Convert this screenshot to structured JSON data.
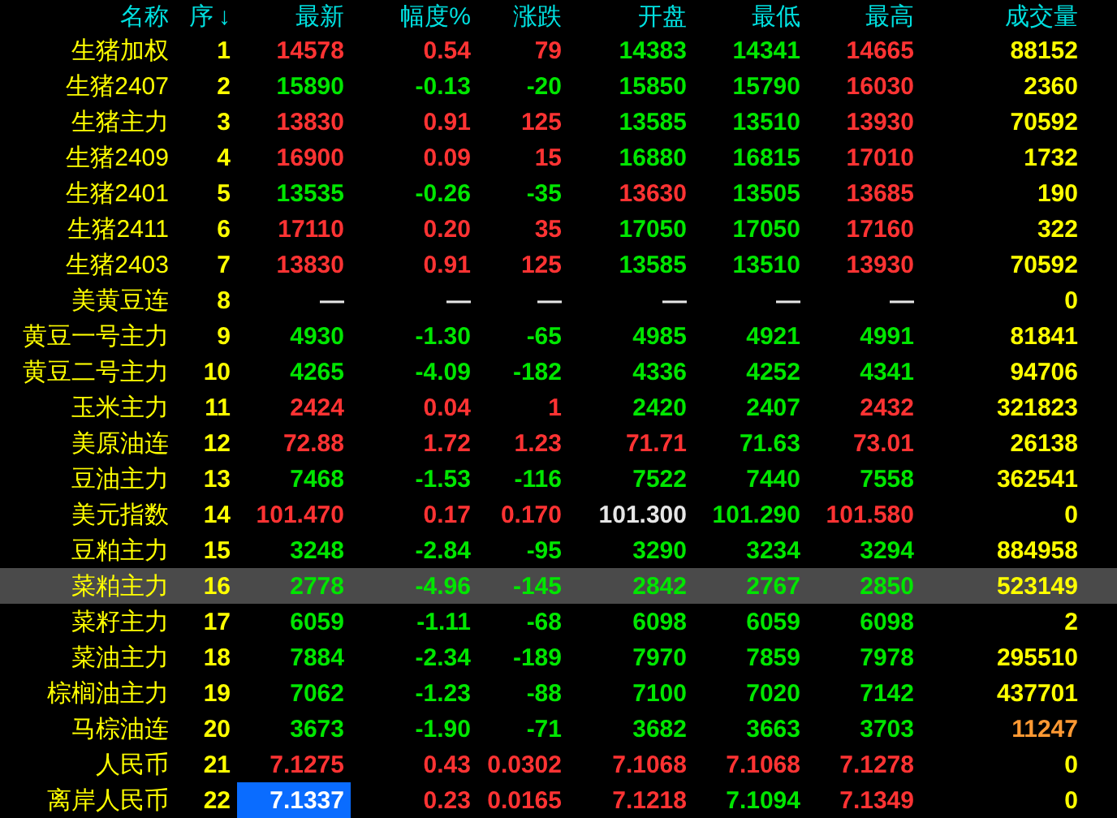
{
  "columns": [
    {
      "label": "名称"
    },
    {
      "label": "序",
      "sort_mark": "↓"
    },
    {
      "label": "最新"
    },
    {
      "label": "幅度%"
    },
    {
      "label": "涨跌"
    },
    {
      "label": "开盘"
    },
    {
      "label": "最低"
    },
    {
      "label": "最高"
    },
    {
      "label": "成交量"
    }
  ],
  "rows": [
    {
      "name": "生猪加权",
      "index": "1",
      "selected": false,
      "cells": [
        {
          "text": "14578",
          "color": "#ff3333"
        },
        {
          "text": "0.54",
          "color": "#ff3333"
        },
        {
          "text": "79",
          "color": "#ff3333"
        },
        {
          "text": "14383",
          "color": "#00e600"
        },
        {
          "text": "14341",
          "color": "#00e600"
        },
        {
          "text": "14665",
          "color": "#ff3333"
        },
        {
          "text": "88152",
          "color": "#ffff00"
        }
      ]
    },
    {
      "name": "生猪2407",
      "index": "2",
      "selected": false,
      "cells": [
        {
          "text": "15890",
          "color": "#00e600"
        },
        {
          "text": "-0.13",
          "color": "#00e600"
        },
        {
          "text": "-20",
          "color": "#00e600"
        },
        {
          "text": "15850",
          "color": "#00e600"
        },
        {
          "text": "15790",
          "color": "#00e600"
        },
        {
          "text": "16030",
          "color": "#ff3333"
        },
        {
          "text": "2360",
          "color": "#ffff00"
        }
      ]
    },
    {
      "name": "生猪主力",
      "index": "3",
      "selected": false,
      "cells": [
        {
          "text": "13830",
          "color": "#ff3333"
        },
        {
          "text": "0.91",
          "color": "#ff3333"
        },
        {
          "text": "125",
          "color": "#ff3333"
        },
        {
          "text": "13585",
          "color": "#00e600"
        },
        {
          "text": "13510",
          "color": "#00e600"
        },
        {
          "text": "13930",
          "color": "#ff3333"
        },
        {
          "text": "70592",
          "color": "#ffff00"
        }
      ]
    },
    {
      "name": "生猪2409",
      "index": "4",
      "selected": false,
      "cells": [
        {
          "text": "16900",
          "color": "#ff3333"
        },
        {
          "text": "0.09",
          "color": "#ff3333"
        },
        {
          "text": "15",
          "color": "#ff3333"
        },
        {
          "text": "16880",
          "color": "#00e600"
        },
        {
          "text": "16815",
          "color": "#00e600"
        },
        {
          "text": "17010",
          "color": "#ff3333"
        },
        {
          "text": "1732",
          "color": "#ffff00"
        }
      ]
    },
    {
      "name": "生猪2401",
      "index": "5",
      "selected": false,
      "cells": [
        {
          "text": "13535",
          "color": "#00e600"
        },
        {
          "text": "-0.26",
          "color": "#00e600"
        },
        {
          "text": "-35",
          "color": "#00e600"
        },
        {
          "text": "13630",
          "color": "#ff3333"
        },
        {
          "text": "13505",
          "color": "#00e600"
        },
        {
          "text": "13685",
          "color": "#ff3333"
        },
        {
          "text": "190",
          "color": "#ffff00"
        }
      ]
    },
    {
      "name": "生猪2411",
      "index": "6",
      "selected": false,
      "cells": [
        {
          "text": "17110",
          "color": "#ff3333"
        },
        {
          "text": "0.20",
          "color": "#ff3333"
        },
        {
          "text": "35",
          "color": "#ff3333"
        },
        {
          "text": "17050",
          "color": "#00e600"
        },
        {
          "text": "17050",
          "color": "#00e600"
        },
        {
          "text": "17160",
          "color": "#ff3333"
        },
        {
          "text": "322",
          "color": "#ffff00"
        }
      ]
    },
    {
      "name": "生猪2403",
      "index": "7",
      "selected": false,
      "cells": [
        {
          "text": "13830",
          "color": "#ff3333"
        },
        {
          "text": "0.91",
          "color": "#ff3333"
        },
        {
          "text": "125",
          "color": "#ff3333"
        },
        {
          "text": "13585",
          "color": "#00e600"
        },
        {
          "text": "13510",
          "color": "#00e600"
        },
        {
          "text": "13930",
          "color": "#ff3333"
        },
        {
          "text": "70592",
          "color": "#ffff00"
        }
      ]
    },
    {
      "name": "美黄豆连",
      "index": "8",
      "selected": false,
      "cells": [
        {
          "text": "—",
          "color": "#e6e6e6"
        },
        {
          "text": "—",
          "color": "#e6e6e6"
        },
        {
          "text": "—",
          "color": "#e6e6e6"
        },
        {
          "text": "—",
          "color": "#e6e6e6"
        },
        {
          "text": "—",
          "color": "#e6e6e6"
        },
        {
          "text": "—",
          "color": "#e6e6e6"
        },
        {
          "text": "0",
          "color": "#ffff00"
        }
      ]
    },
    {
      "name": "黄豆一号主力",
      "index": "9",
      "selected": false,
      "cells": [
        {
          "text": "4930",
          "color": "#00e600"
        },
        {
          "text": "-1.30",
          "color": "#00e600"
        },
        {
          "text": "-65",
          "color": "#00e600"
        },
        {
          "text": "4985",
          "color": "#00e600"
        },
        {
          "text": "4921",
          "color": "#00e600"
        },
        {
          "text": "4991",
          "color": "#00e600"
        },
        {
          "text": "81841",
          "color": "#ffff00"
        }
      ]
    },
    {
      "name": "黄豆二号主力",
      "index": "10",
      "selected": false,
      "cells": [
        {
          "text": "4265",
          "color": "#00e600"
        },
        {
          "text": "-4.09",
          "color": "#00e600"
        },
        {
          "text": "-182",
          "color": "#00e600"
        },
        {
          "text": "4336",
          "color": "#00e600"
        },
        {
          "text": "4252",
          "color": "#00e600"
        },
        {
          "text": "4341",
          "color": "#00e600"
        },
        {
          "text": "94706",
          "color": "#ffff00"
        }
      ]
    },
    {
      "name": "玉米主力",
      "index": "11",
      "selected": false,
      "cells": [
        {
          "text": "2424",
          "color": "#ff3333"
        },
        {
          "text": "0.04",
          "color": "#ff3333"
        },
        {
          "text": "1",
          "color": "#ff3333"
        },
        {
          "text": "2420",
          "color": "#00e600"
        },
        {
          "text": "2407",
          "color": "#00e600"
        },
        {
          "text": "2432",
          "color": "#ff3333"
        },
        {
          "text": "321823",
          "color": "#ffff00"
        }
      ]
    },
    {
      "name": "美原油连",
      "index": "12",
      "selected": false,
      "cells": [
        {
          "text": "72.88",
          "color": "#ff3333"
        },
        {
          "text": "1.72",
          "color": "#ff3333"
        },
        {
          "text": "1.23",
          "color": "#ff3333"
        },
        {
          "text": "71.71",
          "color": "#ff3333"
        },
        {
          "text": "71.63",
          "color": "#00e600"
        },
        {
          "text": "73.01",
          "color": "#ff3333"
        },
        {
          "text": "26138",
          "color": "#ffff00"
        }
      ]
    },
    {
      "name": "豆油主力",
      "index": "13",
      "selected": false,
      "cells": [
        {
          "text": "7468",
          "color": "#00e600"
        },
        {
          "text": "-1.53",
          "color": "#00e600"
        },
        {
          "text": "-116",
          "color": "#00e600"
        },
        {
          "text": "7522",
          "color": "#00e600"
        },
        {
          "text": "7440",
          "color": "#00e600"
        },
        {
          "text": "7558",
          "color": "#00e600"
        },
        {
          "text": "362541",
          "color": "#ffff00"
        }
      ]
    },
    {
      "name": "美元指数",
      "index": "14",
      "selected": false,
      "cells": [
        {
          "text": "101.470",
          "color": "#ff3333"
        },
        {
          "text": "0.17",
          "color": "#ff3333"
        },
        {
          "text": "0.170",
          "color": "#ff3333"
        },
        {
          "text": "101.300",
          "color": "#e6e6e6"
        },
        {
          "text": "101.290",
          "color": "#00e600"
        },
        {
          "text": "101.580",
          "color": "#ff3333"
        },
        {
          "text": "0",
          "color": "#ffff00"
        }
      ]
    },
    {
      "name": "豆粕主力",
      "index": "15",
      "selected": false,
      "cells": [
        {
          "text": "3248",
          "color": "#00e600"
        },
        {
          "text": "-2.84",
          "color": "#00e600"
        },
        {
          "text": "-95",
          "color": "#00e600"
        },
        {
          "text": "3290",
          "color": "#00e600"
        },
        {
          "text": "3234",
          "color": "#00e600"
        },
        {
          "text": "3294",
          "color": "#00e600"
        },
        {
          "text": "884958",
          "color": "#ffff00"
        }
      ]
    },
    {
      "name": "菜粕主力",
      "index": "16",
      "selected": true,
      "cells": [
        {
          "text": "2778",
          "color": "#00e600"
        },
        {
          "text": "-4.96",
          "color": "#00e600"
        },
        {
          "text": "-145",
          "color": "#00e600"
        },
        {
          "text": "2842",
          "color": "#00e600"
        },
        {
          "text": "2767",
          "color": "#00e600"
        },
        {
          "text": "2850",
          "color": "#00e600"
        },
        {
          "text": "523149",
          "color": "#ffff00"
        }
      ]
    },
    {
      "name": "菜籽主力",
      "index": "17",
      "selected": false,
      "cells": [
        {
          "text": "6059",
          "color": "#00e600"
        },
        {
          "text": "-1.11",
          "color": "#00e600"
        },
        {
          "text": "-68",
          "color": "#00e600"
        },
        {
          "text": "6098",
          "color": "#00e600"
        },
        {
          "text": "6059",
          "color": "#00e600"
        },
        {
          "text": "6098",
          "color": "#00e600"
        },
        {
          "text": "2",
          "color": "#ffff00"
        }
      ]
    },
    {
      "name": "菜油主力",
      "index": "18",
      "selected": false,
      "cells": [
        {
          "text": "7884",
          "color": "#00e600"
        },
        {
          "text": "-2.34",
          "color": "#00e600"
        },
        {
          "text": "-189",
          "color": "#00e600"
        },
        {
          "text": "7970",
          "color": "#00e600"
        },
        {
          "text": "7859",
          "color": "#00e600"
        },
        {
          "text": "7978",
          "color": "#00e600"
        },
        {
          "text": "295510",
          "color": "#ffff00"
        }
      ]
    },
    {
      "name": "棕榈油主力",
      "index": "19",
      "selected": false,
      "cells": [
        {
          "text": "7062",
          "color": "#00e600"
        },
        {
          "text": "-1.23",
          "color": "#00e600"
        },
        {
          "text": "-88",
          "color": "#00e600"
        },
        {
          "text": "7100",
          "color": "#00e600"
        },
        {
          "text": "7020",
          "color": "#00e600"
        },
        {
          "text": "7142",
          "color": "#00e600"
        },
        {
          "text": "437701",
          "color": "#ffff00"
        }
      ]
    },
    {
      "name": "马棕油连",
      "index": "20",
      "selected": false,
      "cells": [
        {
          "text": "3673",
          "color": "#00e600"
        },
        {
          "text": "-1.90",
          "color": "#00e600"
        },
        {
          "text": "-71",
          "color": "#00e600"
        },
        {
          "text": "3682",
          "color": "#00e600"
        },
        {
          "text": "3663",
          "color": "#00e600"
        },
        {
          "text": "3703",
          "color": "#00e600"
        },
        {
          "text": "11247",
          "color": "#ff9933"
        }
      ]
    },
    {
      "name": "人民币",
      "index": "21",
      "selected": false,
      "cells": [
        {
          "text": "7.1275",
          "color": "#ff3333"
        },
        {
          "text": "0.43",
          "color": "#ff3333"
        },
        {
          "text": "0.0302",
          "color": "#ff3333"
        },
        {
          "text": "7.1068",
          "color": "#ff3333"
        },
        {
          "text": "7.1068",
          "color": "#ff3333"
        },
        {
          "text": "7.1278",
          "color": "#ff3333"
        },
        {
          "text": "0",
          "color": "#ffff00"
        }
      ]
    },
    {
      "name": "离岸人民币",
      "index": "22",
      "selected": false,
      "cells": [
        {
          "text": "7.1337",
          "color": "#ffffff",
          "focused": true
        },
        {
          "text": "0.23",
          "color": "#ff3333"
        },
        {
          "text": "0.0165",
          "color": "#ff3333"
        },
        {
          "text": "7.1218",
          "color": "#ff3333"
        },
        {
          "text": "7.1094",
          "color": "#00e600"
        },
        {
          "text": "7.1349",
          "color": "#ff3333"
        },
        {
          "text": "0",
          "color": "#ffff00"
        }
      ]
    }
  ]
}
